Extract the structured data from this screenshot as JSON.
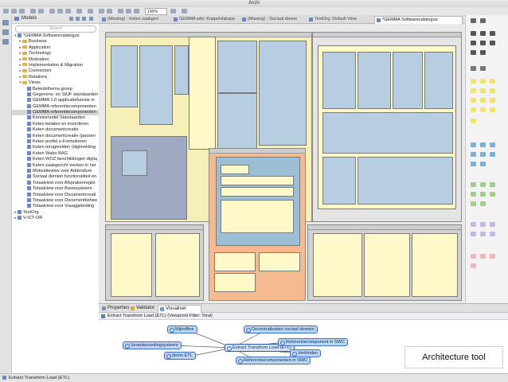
{
  "window": {
    "title": "Archi"
  },
  "toolbar": {
    "zoom_value": "100%"
  },
  "models_panel": {
    "title": "Models",
    "search_placeholder": "Search",
    "tree": [
      {
        "label": "*GEMMA Softwarecatalogus",
        "level": 1,
        "kind": "model",
        "expanded": true
      },
      {
        "label": "Business",
        "level": 2,
        "kind": "folder"
      },
      {
        "label": "Application",
        "level": 2,
        "kind": "folder"
      },
      {
        "label": "Technology",
        "level": 2,
        "kind": "folder"
      },
      {
        "label": "Motivation",
        "level": 2,
        "kind": "folder"
      },
      {
        "label": "Implementation & Migration",
        "level": 2,
        "kind": "folder"
      },
      {
        "label": "Connectors",
        "level": 2,
        "kind": "folder"
      },
      {
        "label": "Relations",
        "level": 2,
        "kind": "folder"
      },
      {
        "label": "Views",
        "level": 2,
        "kind": "folder",
        "expanded": true
      },
      {
        "label": "Beleidsthema groep",
        "level": 3,
        "kind": "view"
      },
      {
        "label": "Gegevens- en StUF standaarden",
        "level": 3,
        "kind": "view"
      },
      {
        "label": "GEMMA 1.0 applicatiefunctie in",
        "level": 3,
        "kind": "view"
      },
      {
        "label": "GEMMA referentiecomponenten",
        "level": 3,
        "kind": "view"
      },
      {
        "label": "GEMMA referentiecomponenten",
        "level": 3,
        "kind": "view",
        "selected": true
      },
      {
        "label": "Kennismodel Standaarden",
        "level": 3,
        "kind": "view"
      },
      {
        "label": "Keten betalen en invorderen",
        "level": 3,
        "kind": "view"
      },
      {
        "label": "Keten documentcreatie",
        "level": 3,
        "kind": "view"
      },
      {
        "label": "Keten documentcreatie (passen",
        "level": 3,
        "kind": "view"
      },
      {
        "label": "Keten profiel e-Formulieren",
        "level": 3,
        "kind": "view"
      },
      {
        "label": "Keten terugmelden (digimelding",
        "level": 3,
        "kind": "view"
      },
      {
        "label": "Keten Wabo BAG",
        "level": 3,
        "kind": "view"
      },
      {
        "label": "Keten WOZ beschikkingen digita",
        "level": 3,
        "kind": "view"
      },
      {
        "label": "Keten zaakgericht werken in het",
        "level": 3,
        "kind": "view"
      },
      {
        "label": "Motivatieview voor Addendum",
        "level": 3,
        "kind": "view"
      },
      {
        "label": "Sociaal domein functionaliteit en",
        "level": 3,
        "kind": "view"
      },
      {
        "label": "Totaalview voor Afsprakenregist",
        "level": 3,
        "kind": "view"
      },
      {
        "label": "Totaalview voor Basissysteem",
        "level": 3,
        "kind": "view"
      },
      {
        "label": "Totaalview voor Documentcreati",
        "level": 3,
        "kind": "view"
      },
      {
        "label": "Totaalview voor Documentbehee",
        "level": 3,
        "kind": "view"
      },
      {
        "label": "Totaalview voor Vraaggeleiding",
        "level": 3,
        "kind": "view"
      },
      {
        "label": "TestOrg",
        "level": 1,
        "kind": "model"
      },
      {
        "label": "V-ICT-OR",
        "level": 1,
        "kind": "model"
      }
    ]
  },
  "editor": {
    "tabs": [
      {
        "label": "(Missing) - Keten zaakgeri",
        "active": false
      },
      {
        "label": "GEMMA wiki: Koppelvlakspe",
        "active": false
      },
      {
        "label": "(Missing) - Sociaal domei",
        "active": false
      },
      {
        "label": "TestOrg: Default View",
        "active": false
      },
      {
        "label": "*GEMMA Softwarecatalogus:",
        "active": true
      }
    ]
  },
  "bottom_panel": {
    "tabs": [
      {
        "label": "Properties",
        "active": false
      },
      {
        "label": "Validator",
        "active": false
      },
      {
        "label": "Visualiser",
        "active": true
      }
    ],
    "viewpoint_title": "Extract Transform Load (ETL) (Viewpoint Filter: Total)",
    "graph": {
      "center": "Extract Transform Load (ETL)",
      "nodes": [
        "Mijnoffice",
        "Decentralisaties sociaal domein",
        "Verantwoordingsysteem",
        "Referentiecomponent in SWC",
        "Verbinden",
        "demo ETL",
        "Referentiecomponenten in SWC"
      ]
    }
  },
  "statusbar": {
    "text": "Extract Transform Load (ETL)"
  },
  "caption": "Architecture tool"
}
